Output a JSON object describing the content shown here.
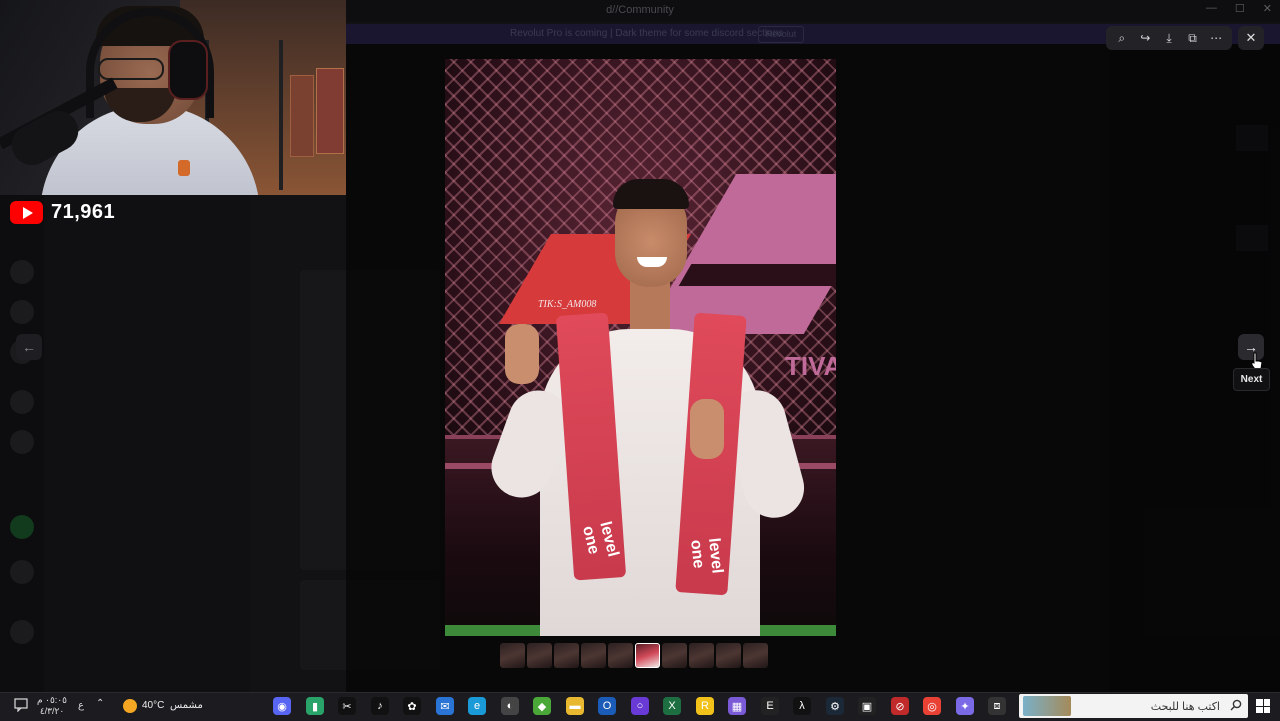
{
  "app": {
    "title": "d//Community",
    "banner_text": "Revolut Pro is coming | Dark theme for some discord sections",
    "banner_button": "Revolut"
  },
  "stream": {
    "youtube_viewers": "71,961"
  },
  "viewer": {
    "toolbar": [
      {
        "name": "zoom-icon",
        "glyph": "⌕"
      },
      {
        "name": "share-icon",
        "glyph": "↪"
      },
      {
        "name": "download-icon",
        "glyph": "⤓"
      },
      {
        "name": "open-external-icon",
        "glyph": "⧉"
      },
      {
        "name": "more-icon",
        "glyph": "⋯"
      }
    ],
    "close_glyph": "✕",
    "prev_glyph": "←",
    "next_glyph": "→",
    "next_tooltip": "Next",
    "photo_watermark": "TIK:S_AM008",
    "photo_sign_text": "TIVA",
    "scarf_text": "level one",
    "thumbnail_count": 10,
    "active_thumbnail": 5
  },
  "taskbar": {
    "clock_time": "٠٥:٠٥ م",
    "clock_date": "٤/٣/٢٠",
    "language": "ع",
    "temperature": "40°C",
    "weather": "مشمس",
    "search_placeholder": "اكتب هنا للبحث",
    "apps": [
      {
        "name": "discord-icon",
        "color": "#5865f2",
        "glyph": "◉"
      },
      {
        "name": "app-green-icon",
        "color": "#2aa36a",
        "glyph": "▮"
      },
      {
        "name": "capcut-icon",
        "color": "#111",
        "glyph": "✂"
      },
      {
        "name": "tiktok-icon",
        "color": "#111",
        "glyph": "♪"
      },
      {
        "name": "openai-icon",
        "color": "#111",
        "glyph": "✿"
      },
      {
        "name": "outlook-icon",
        "color": "#2a74d6",
        "glyph": "✉"
      },
      {
        "name": "edge-icon",
        "color": "#1a9ad6",
        "glyph": "e"
      },
      {
        "name": "app-white-icon",
        "color": "#444",
        "glyph": "◐"
      },
      {
        "name": "app-lime-icon",
        "color": "#4aa838",
        "glyph": "◆"
      },
      {
        "name": "file-explorer-icon",
        "color": "#e8b830",
        "glyph": "▬"
      },
      {
        "name": "outlook-classic-icon",
        "color": "#1a5cb8",
        "glyph": "O"
      },
      {
        "name": "obs-icon",
        "color": "#6a3ad6",
        "glyph": "○"
      },
      {
        "name": "excel-icon",
        "color": "#1d6f42",
        "glyph": "X"
      },
      {
        "name": "rockstar-icon",
        "color": "#f2c21a",
        "glyph": "R"
      },
      {
        "name": "app-grid-icon",
        "color": "#7a5ad6",
        "glyph": "▦"
      },
      {
        "name": "epic-games-icon",
        "color": "#222",
        "glyph": "E"
      },
      {
        "name": "nvidia-icon",
        "color": "#111",
        "glyph": "λ"
      },
      {
        "name": "steam-icon",
        "color": "#1b2838",
        "glyph": "⚙"
      },
      {
        "name": "app-box-icon",
        "color": "#222",
        "glyph": "▣"
      },
      {
        "name": "app-red-icon",
        "color": "#c02a2a",
        "glyph": "⊘"
      },
      {
        "name": "chrome-icon",
        "color": "#e94235",
        "glyph": "◎"
      },
      {
        "name": "copilot-icon",
        "color": "#7a6ae6",
        "glyph": "✦"
      },
      {
        "name": "task-view-icon",
        "color": "#333",
        "glyph": "⧈"
      }
    ]
  }
}
